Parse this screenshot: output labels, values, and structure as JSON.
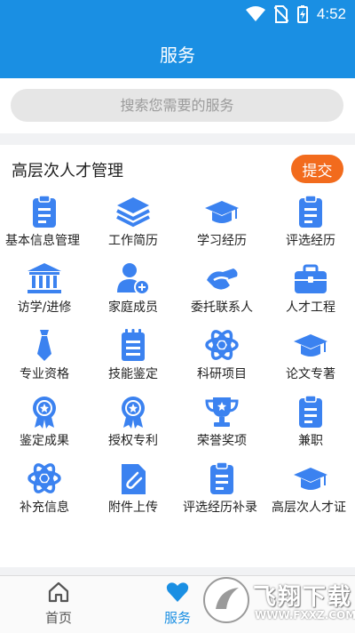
{
  "status_bar": {
    "time": "4:52"
  },
  "header": {
    "title": "服务"
  },
  "search": {
    "placeholder": "搜索您需要的服务"
  },
  "section": {
    "title": "高层次人才管理",
    "submit_label": "提交",
    "items": [
      {
        "label": "基本信息管理",
        "icon": "clipboard-icon"
      },
      {
        "label": "工作简历",
        "icon": "layers-icon"
      },
      {
        "label": "学习经历",
        "icon": "graduation-cap-icon"
      },
      {
        "label": "评选经历",
        "icon": "clipboard-icon"
      },
      {
        "label": "访学/进修",
        "icon": "institution-icon"
      },
      {
        "label": "家庭成员",
        "icon": "user-add-icon"
      },
      {
        "label": "委托联系人",
        "icon": "handshake-icon"
      },
      {
        "label": "人才工程",
        "icon": "briefcase-icon"
      },
      {
        "label": "专业资格",
        "icon": "tie-icon"
      },
      {
        "label": "技能鉴定",
        "icon": "notepad-icon"
      },
      {
        "label": "科研项目",
        "icon": "atom-icon"
      },
      {
        "label": "论文专著",
        "icon": "graduation-cap-icon"
      },
      {
        "label": "鉴定成果",
        "icon": "medal-icon"
      },
      {
        "label": "授权专利",
        "icon": "medal-icon"
      },
      {
        "label": "荣誉奖项",
        "icon": "trophy-icon"
      },
      {
        "label": "兼职",
        "icon": "clipboard-icon"
      },
      {
        "label": "补充信息",
        "icon": "atom-icon"
      },
      {
        "label": "附件上传",
        "icon": "attachment-icon"
      },
      {
        "label": "评选经历补录",
        "icon": "clipboard-icon"
      },
      {
        "label": "高层次人才证",
        "icon": "graduation-cap-icon"
      }
    ]
  },
  "bottom_nav": {
    "items": [
      {
        "label": "首页",
        "icon": "home-icon",
        "active": false
      },
      {
        "label": "服务",
        "icon": "heart-icon",
        "active": true
      }
    ]
  },
  "watermark": {
    "text": "飞翔下载",
    "url_text": "WWW.FXXZ.COM"
  },
  "colors": {
    "primary": "#1a8fe3",
    "accent": "#f26b1d",
    "icon_blue": "#3b82f0"
  }
}
